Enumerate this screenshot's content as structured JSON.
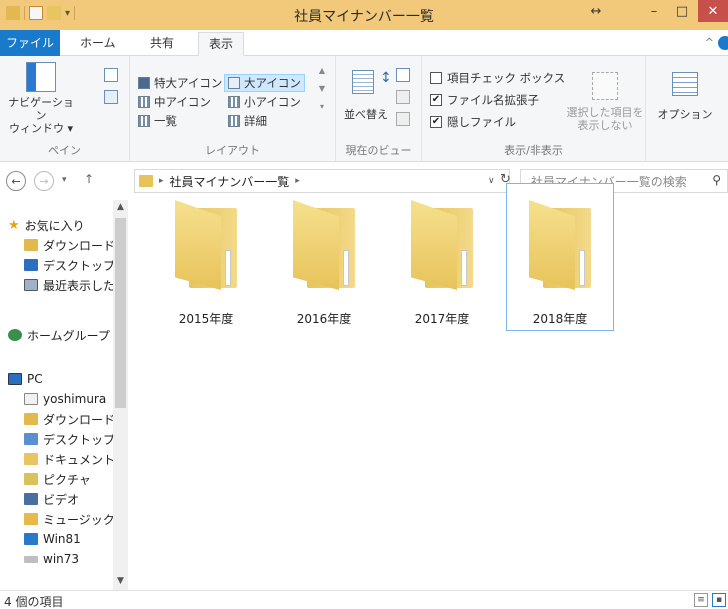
{
  "window": {
    "title": "社員マイナンバー一覧",
    "title_bar_color": "#f2c97a",
    "resize_glyph": "↔",
    "minimize_glyph": "–",
    "maximize_glyph": "□",
    "close_glyph": "✕"
  },
  "ribbon_tabs": [
    {
      "label": "ファイル",
      "active": false
    },
    {
      "label": "ホーム",
      "active": false
    },
    {
      "label": "共有",
      "active": false
    },
    {
      "label": "表示",
      "active": true
    }
  ],
  "ribbon": {
    "pane": {
      "nav_pane_line1": "ナビゲーション",
      "nav_pane_line2": "ウィンドウ ▾",
      "label": "ペイン"
    },
    "layout": {
      "items": [
        "特大アイコン",
        "大アイコン",
        "中アイコン",
        "小アイコン",
        "一覧",
        "詳細"
      ],
      "selected": "大アイコン",
      "label": "レイアウト"
    },
    "current_view": {
      "sort_label": "並べ替え",
      "label": "現在のビュー"
    },
    "show_hide": {
      "checks": [
        {
          "label": "項目チェック ボックス",
          "checked": false
        },
        {
          "label": "ファイル名拡張子",
          "checked": true
        },
        {
          "label": "隠しファイル",
          "checked": true
        }
      ],
      "hide_selected_line1": "選択した項目を",
      "hide_selected_line2": "表示しない",
      "label": "表示/非表示"
    },
    "options_label": "オプション"
  },
  "address_bar": {
    "path_separator": "▸",
    "path": "社員マイナンバー一覧",
    "dropdown_glyph": "∨",
    "refresh_glyph": "↻",
    "search_placeholder": "社員マイナンバー一覧の検索"
  },
  "nav_pane": {
    "items": [
      {
        "label": "お気に入り",
        "icon": "star-icon",
        "sub": false
      },
      {
        "label": "ダウンロード",
        "icon": "download-folder-icon",
        "sub": true
      },
      {
        "label": "デスクトップ",
        "icon": "desktop-icon",
        "sub": true
      },
      {
        "label": "最近表示した場所",
        "icon": "recent-places-icon",
        "sub": true
      },
      {
        "label": "ホームグループ",
        "icon": "homegroup-icon",
        "sub": false
      },
      {
        "label": "PC",
        "icon": "pc-icon",
        "sub": false
      },
      {
        "label": "yoshimura",
        "icon": "user-folder-icon",
        "sub": true
      },
      {
        "label": "ダウンロード",
        "icon": "download-folder-icon",
        "sub": true
      },
      {
        "label": "デスクトップ",
        "icon": "desktop-folder-icon",
        "sub": true
      },
      {
        "label": "ドキュメント",
        "icon": "documents-icon",
        "sub": true
      },
      {
        "label": "ピクチャ",
        "icon": "pictures-icon",
        "sub": true
      },
      {
        "label": "ビデオ",
        "icon": "videos-icon",
        "sub": true
      },
      {
        "label": "ミュージック",
        "icon": "music-icon",
        "sub": true
      },
      {
        "label": "Win81",
        "icon": "drive-icon",
        "sub": true
      },
      {
        "label": "win73",
        "icon": "network-drive-icon",
        "sub": true
      }
    ]
  },
  "folders": [
    {
      "label": "2015年度",
      "selected": false
    },
    {
      "label": "2016年度",
      "selected": false
    },
    {
      "label": "2017年度",
      "selected": false
    },
    {
      "label": "2018年度",
      "selected": true
    }
  ],
  "status_bar": {
    "item_count": "4 個の項目"
  }
}
